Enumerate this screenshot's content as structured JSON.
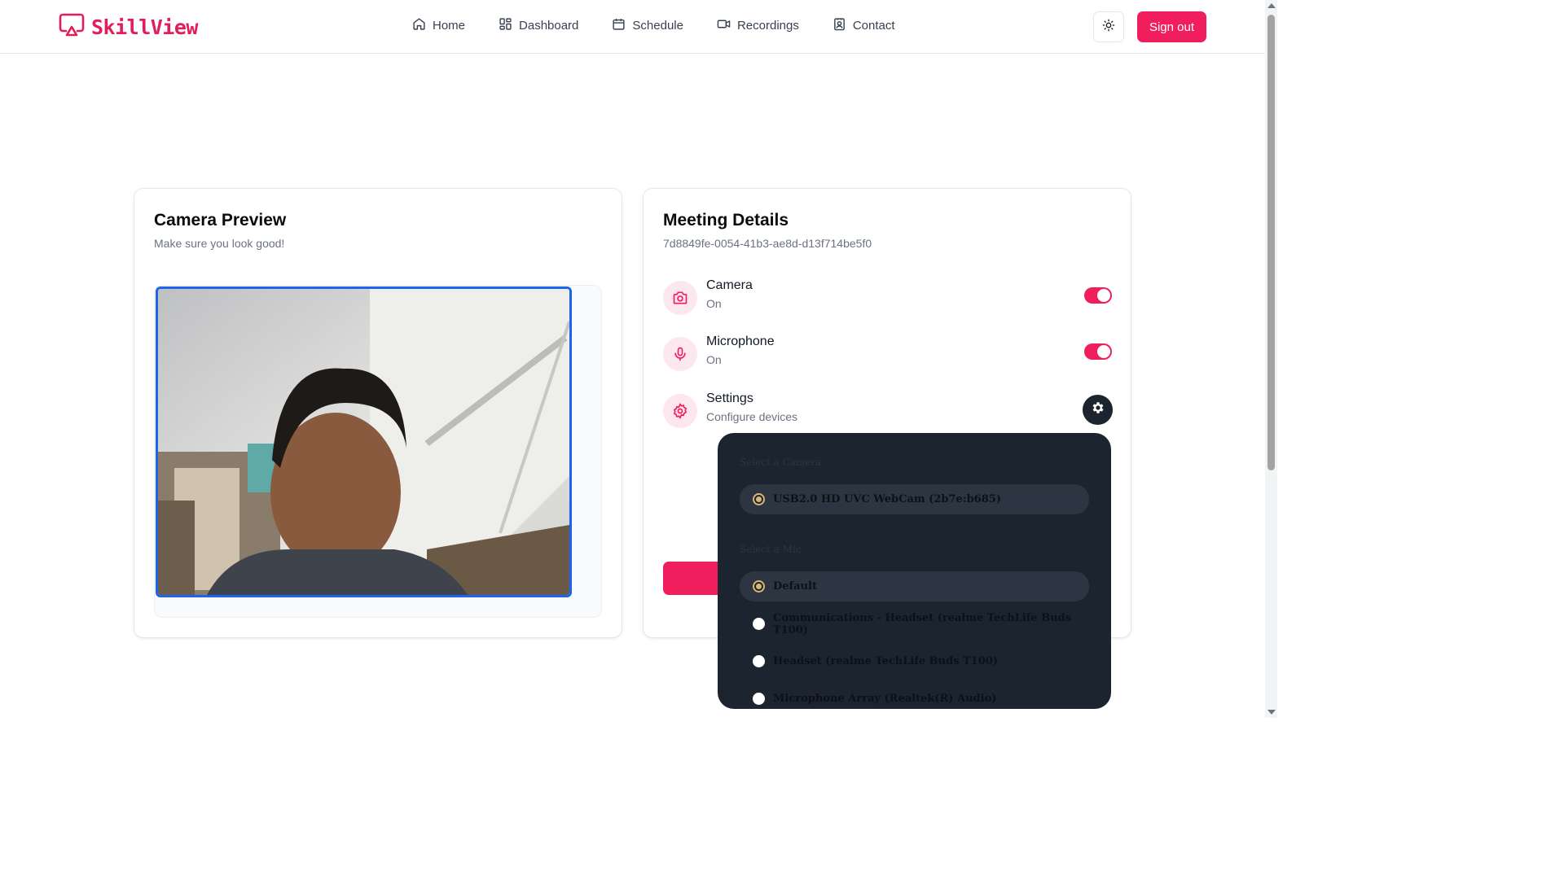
{
  "app": {
    "name": "SkillView",
    "brand_color": "#f01e5c"
  },
  "nav": {
    "items": [
      {
        "label": "Home",
        "icon": "home-icon"
      },
      {
        "label": "Dashboard",
        "icon": "dashboard-icon"
      },
      {
        "label": "Schedule",
        "icon": "calendar-icon"
      },
      {
        "label": "Recordings",
        "icon": "video-icon"
      },
      {
        "label": "Contact",
        "icon": "contact-icon"
      }
    ],
    "theme_toggle_icon": "sun-icon",
    "sign_out_label": "Sign out"
  },
  "camera_preview": {
    "title": "Camera Preview",
    "subtitle": "Make sure you look good!"
  },
  "meeting": {
    "title": "Meeting Details",
    "id": "7d8849fe-0054-41b3-ae8d-d13f714be5f0",
    "camera": {
      "label": "Camera",
      "status": "On",
      "enabled": true
    },
    "microphone": {
      "label": "Microphone",
      "status": "On",
      "enabled": true
    },
    "settings": {
      "label": "Settings",
      "description": "Configure devices"
    }
  },
  "device_menu": {
    "camera_heading": "Select a Camera",
    "cameras": [
      {
        "label": "USB2.0 HD UVC WebCam (2b7e:b685)",
        "selected": true
      }
    ],
    "mic_heading": "Select a Mic",
    "mics": [
      {
        "label": "Default",
        "selected": true
      },
      {
        "label": "Communications - Headset (realme TechLife Buds T100)",
        "selected": false
      },
      {
        "label": "Headset (realme TechLife Buds T100)",
        "selected": false
      },
      {
        "label": "Microphone Array (Realtek(R) Audio)",
        "selected": false
      }
    ]
  }
}
